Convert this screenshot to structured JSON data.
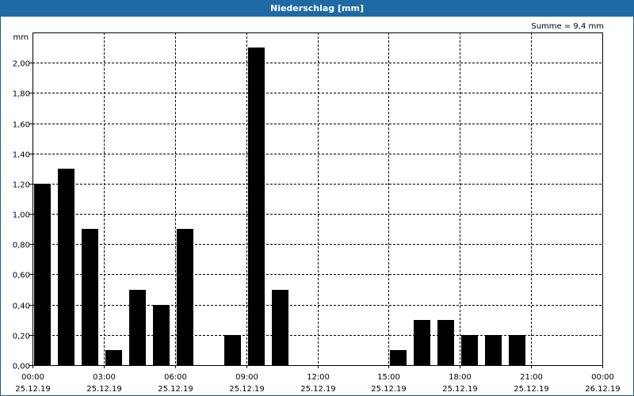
{
  "window": {
    "title": "Niederschlag [mm]"
  },
  "summary": "Summe = 9,4 mm",
  "colors": {
    "titlebar": "#1f6aa5",
    "bar": "#000000",
    "grid": "#000000"
  },
  "chart_data": {
    "type": "bar",
    "title": "Niederschlag [mm]",
    "ylabel": "mm",
    "ylim": [
      0,
      2.2
    ],
    "yticks": [
      "0,00",
      "0,20",
      "0,40",
      "0,60",
      "0,80",
      "1,00",
      "1,20",
      "1,40",
      "1,60",
      "1,80",
      "2,00"
    ],
    "xlim_hours": [
      0,
      24
    ],
    "xticks": [
      {
        "time": "00:00",
        "date": "25.12.19"
      },
      {
        "time": "03:00",
        "date": "25.12.19"
      },
      {
        "time": "06:00",
        "date": "25.12.19"
      },
      {
        "time": "09:00",
        "date": "25.12.19"
      },
      {
        "time": "12:00",
        "date": "25.12.19"
      },
      {
        "time": "15:00",
        "date": "25.12.19"
      },
      {
        "time": "18:00",
        "date": "25.12.19"
      },
      {
        "time": "21:00",
        "date": "25.12.19"
      },
      {
        "time": "00:00",
        "date": "26.12.19"
      }
    ],
    "grid": true,
    "interval_hours": 1,
    "values": [
      1.2,
      1.3,
      0.9,
      0.1,
      0.5,
      0.4,
      0.9,
      0,
      0.2,
      2.1,
      0.5,
      0,
      0,
      0,
      0,
      0.1,
      0.3,
      0.3,
      0.2,
      0.2,
      0.2,
      0,
      0,
      0
    ]
  }
}
